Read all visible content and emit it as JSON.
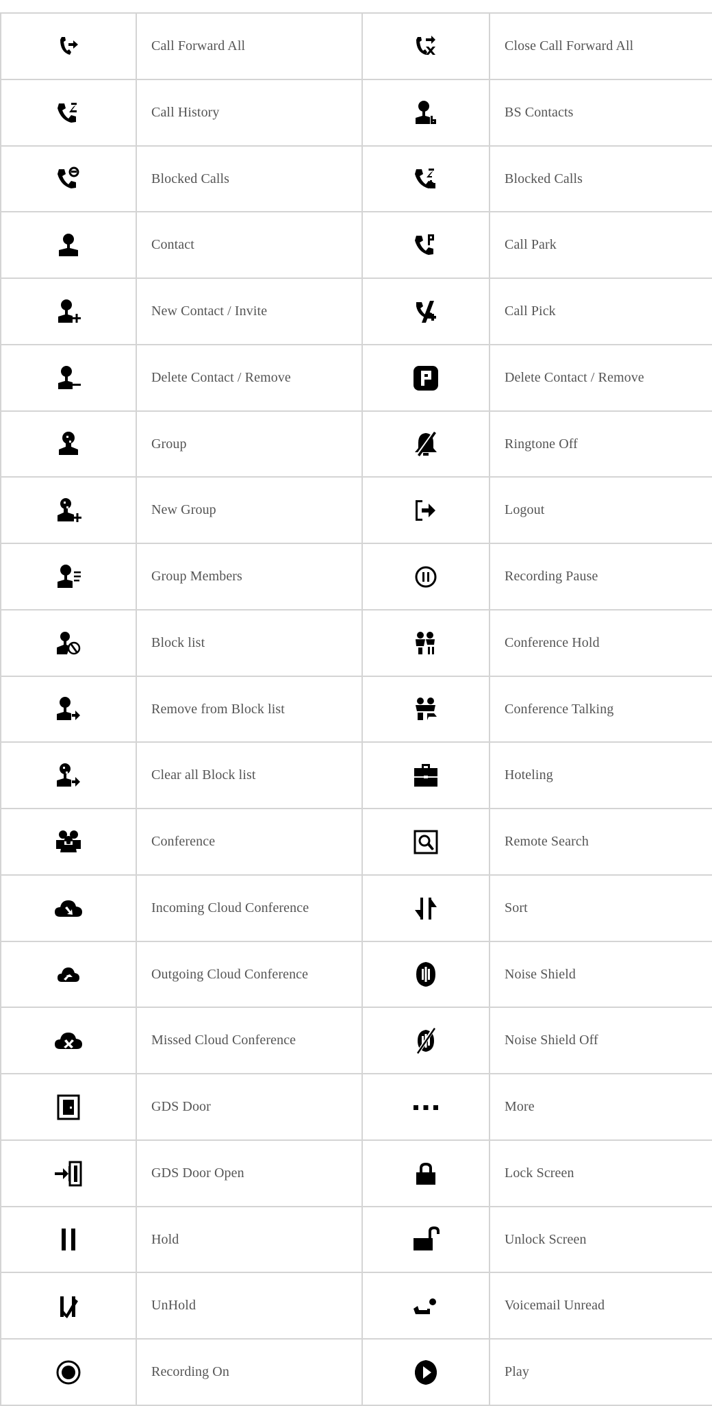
{
  "rows": [
    {
      "left": {
        "icon": "call-forward-all-icon",
        "label": "Call Forward All"
      },
      "right": {
        "icon": "close-call-forward-all-icon",
        "label": "Close Call Forward All"
      }
    },
    {
      "left": {
        "icon": "call-history-icon",
        "label": "Call History"
      },
      "right": {
        "icon": "bs-contacts-icon",
        "label": "BS Contacts"
      }
    },
    {
      "left": {
        "icon": "blocked-calls-icon",
        "label": "Blocked Calls"
      },
      "right": {
        "icon": "blocked-calls-b-icon",
        "label": "Blocked Calls"
      }
    },
    {
      "left": {
        "icon": "contact-icon",
        "label": "Contact"
      },
      "right": {
        "icon": "call-park-icon",
        "label": "Call Park"
      }
    },
    {
      "left": {
        "icon": "new-contact-icon",
        "label": "New Contact / Invite"
      },
      "right": {
        "icon": "call-pick-icon",
        "label": "Call Pick"
      }
    },
    {
      "left": {
        "icon": "delete-contact-icon",
        "label": "Delete Contact / Remove"
      },
      "right": {
        "icon": "park-p-icon",
        "label": "Delete Contact / Remove"
      }
    },
    {
      "left": {
        "icon": "group-icon",
        "label": "Group"
      },
      "right": {
        "icon": "ringtone-off-icon",
        "label": "Ringtone Off"
      }
    },
    {
      "left": {
        "icon": "new-group-icon",
        "label": "New Group"
      },
      "right": {
        "icon": "logout-icon",
        "label": "Logout"
      }
    },
    {
      "left": {
        "icon": "group-members-icon",
        "label": "Group Members"
      },
      "right": {
        "icon": "recording-pause-icon",
        "label": "Recording Pause"
      }
    },
    {
      "left": {
        "icon": "block-list-icon",
        "label": "Block list"
      },
      "right": {
        "icon": "conference-hold-icon",
        "label": "Conference Hold"
      }
    },
    {
      "left": {
        "icon": "remove-block-list-icon",
        "label": "Remove from Block list"
      },
      "right": {
        "icon": "conference-talking-icon",
        "label": "Conference Talking"
      }
    },
    {
      "left": {
        "icon": "clear-block-list-icon",
        "label": "Clear all Block list"
      },
      "right": {
        "icon": "hoteling-icon",
        "label": "Hoteling"
      }
    },
    {
      "left": {
        "icon": "conference-icon",
        "label": "Conference"
      },
      "right": {
        "icon": "remote-search-icon",
        "label": "Remote Search"
      }
    },
    {
      "left": {
        "icon": "incoming-cloud-conference-icon",
        "label": "Incoming Cloud Conference"
      },
      "right": {
        "icon": "sort-icon",
        "label": "Sort"
      }
    },
    {
      "left": {
        "icon": "outgoing-cloud-conference-icon",
        "label": "Outgoing Cloud Conference"
      },
      "right": {
        "icon": "noise-shield-icon",
        "label": "Noise Shield"
      }
    },
    {
      "left": {
        "icon": "missed-cloud-conference-icon",
        "label": "Missed Cloud Conference"
      },
      "right": {
        "icon": "noise-shield-off-icon",
        "label": " Noise Shield Off"
      }
    },
    {
      "left": {
        "icon": "gds-door-icon",
        "label": "GDS Door"
      },
      "right": {
        "icon": "more-icon",
        "label": "More"
      }
    },
    {
      "left": {
        "icon": "gds-door-open-icon",
        "label": "GDS Door Open"
      },
      "right": {
        "icon": "lock-screen-icon",
        "label": "Lock Screen"
      }
    },
    {
      "left": {
        "icon": "hold-icon",
        "label": "Hold"
      },
      "right": {
        "icon": "unlock-screen-icon",
        "label": "Unlock Screen"
      }
    },
    {
      "left": {
        "icon": "unhold-icon",
        "label": "UnHold"
      },
      "right": {
        "icon": "voicemail-unread-icon",
        "label": "Voicemail Unread"
      }
    },
    {
      "left": {
        "icon": "recording-on-icon",
        "label": "Recording On"
      },
      "right": {
        "icon": "play-icon",
        "label": "Play"
      }
    }
  ]
}
